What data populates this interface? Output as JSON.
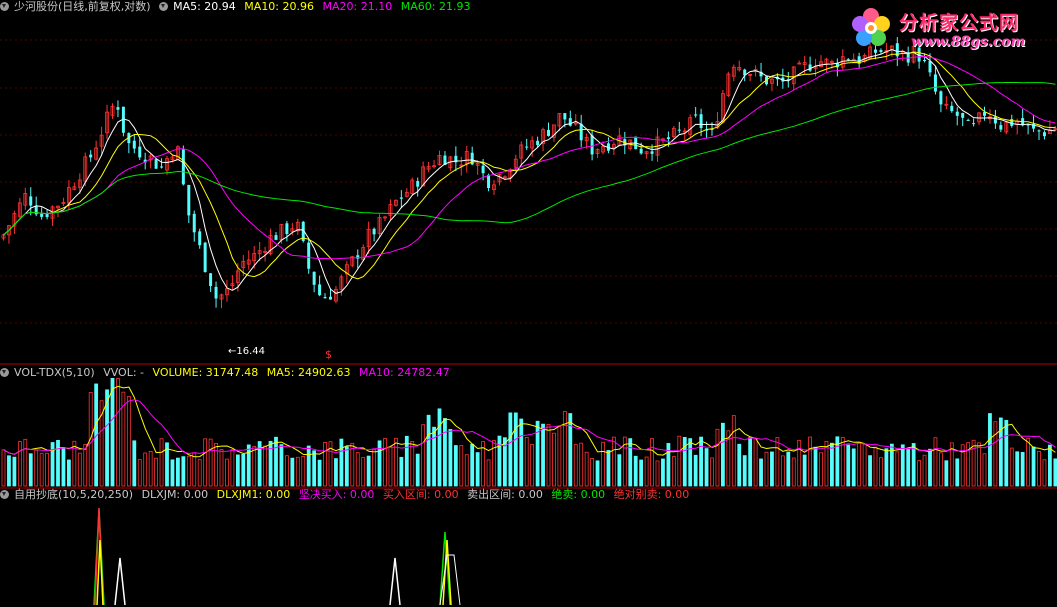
{
  "main_panel": {
    "name": "少河股份(日线,前复权,对数)",
    "ma5": "MA5: 20.94",
    "ma10": "MA10: 20.96",
    "ma20": "MA20: 21.10",
    "ma60": "MA60: 21.93",
    "low_marker": "←16.44",
    "signal_mark": "$"
  },
  "volume_panel": {
    "name": "VOL-TDX(5,10)",
    "vvol": "VVOL: -",
    "volume": "VOLUME: 31747.48",
    "ma5": "MA5: 24902.63",
    "ma10": "MA10: 24782.47"
  },
  "indicator_panel": {
    "name": "自用抄底(10,5,20,250)",
    "dlxjm": "DLXJM: 0.00",
    "dlxjm1": "DLXJM1: 0.00",
    "jianjue_label": "坚决买入:",
    "jianjue_value": "0.00",
    "mairu_label": "买入区间:",
    "mairu_value": "0.00",
    "maichu_label": "卖出区间:",
    "maichu_value": "0.00",
    "juemai_label": "绝卖:",
    "juemai_value": "0.00",
    "juedui_label": "绝对别卖:",
    "juedui_value": "0.00"
  },
  "logo": {
    "title": "分析家公式网",
    "url": "www.88gs.com"
  },
  "colors": {
    "up": "#ff3232",
    "down": "#54fcfc",
    "ma5": "#ffffff",
    "ma10": "#ffff00",
    "ma20": "#ff00ff",
    "ma60": "#00e600",
    "separator": "#b00000"
  }
}
